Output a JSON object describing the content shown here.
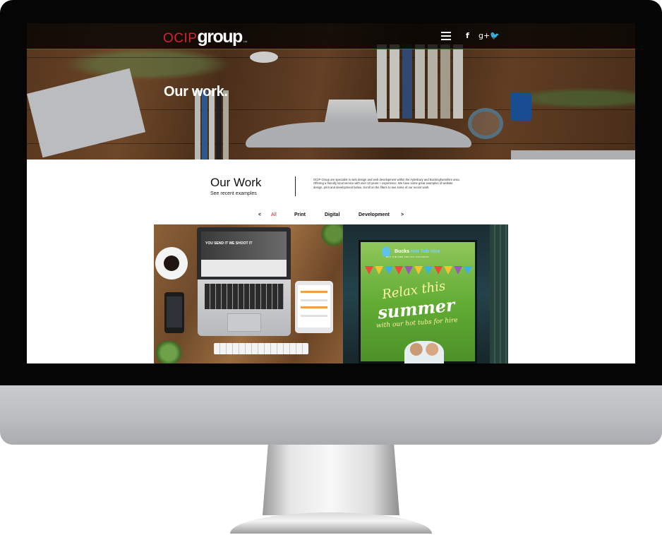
{
  "header": {
    "logo_ocip": "OCIP",
    "logo_group": "group",
    "logo_suffix": "Ltd"
  },
  "icons": {
    "menu": "hamburger-menu-icon",
    "facebook": "facebook-icon",
    "google_plus": "google-plus-icon",
    "twitter": "twitter-icon"
  },
  "social": {
    "facebook_glyph": "f",
    "google_plus_glyph": "g+",
    "twitter_glyph": "🐦"
  },
  "hero": {
    "title": "Our work."
  },
  "intro": {
    "title": "Our Work",
    "subtitle": "See recent examples",
    "description": "OCIP Group are specialist in web design and web development within the Aylesbury and Buckinghamshire area. Offering a friendly local service with over 10 years + experience. We have some great examples of website design, print and development below. Scroll on the filters to see some of our recent work."
  },
  "filters": {
    "prev": "<",
    "items": [
      "All",
      "Print",
      "Digital",
      "Development"
    ],
    "active": "All",
    "next": ">"
  },
  "portfolio": {
    "website_tile": {
      "hero_text": "YOU SEND IT WE SHOOT IT"
    },
    "poster_tile": {
      "brand_a": "Bucks",
      "brand_b": "Hot Tub Hire",
      "tagline": "HOT TUB HIRE FOR ANY OCCASION",
      "line1": "Relax this",
      "line2": "summer",
      "line3": "with our hot tubs for hire"
    }
  },
  "colors": {
    "brand_red": "#d9202e",
    "nav_bg": "#000000",
    "text_dark": "#111111"
  }
}
